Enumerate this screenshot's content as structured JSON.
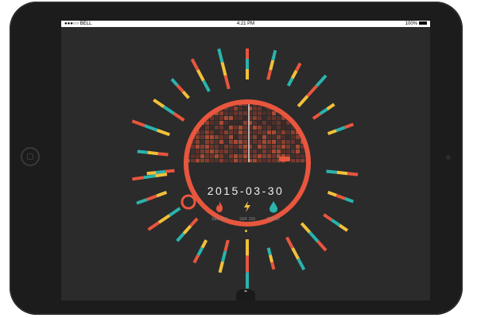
{
  "status_bar": {
    "carrier": "●●●○○ BELL",
    "time": "4:21 PM",
    "battery": "100%"
  },
  "date": "2015-03-30",
  "stats": [
    {
      "icon": "flame-icon",
      "label": "SEK 154",
      "color": "#e8563e"
    },
    {
      "icon": "lightning-icon",
      "label": "SEK 150",
      "color": "#f2c13a"
    },
    {
      "icon": "water-drop-icon",
      "label": "SEK 87",
      "color": "#2bb3ad"
    }
  ],
  "colors": {
    "ring": "#e8563e",
    "yellow": "#f2c13a",
    "teal": "#2bb3ad",
    "orange": "#e8563e"
  },
  "handle_icon": "chevron-up-icon"
}
